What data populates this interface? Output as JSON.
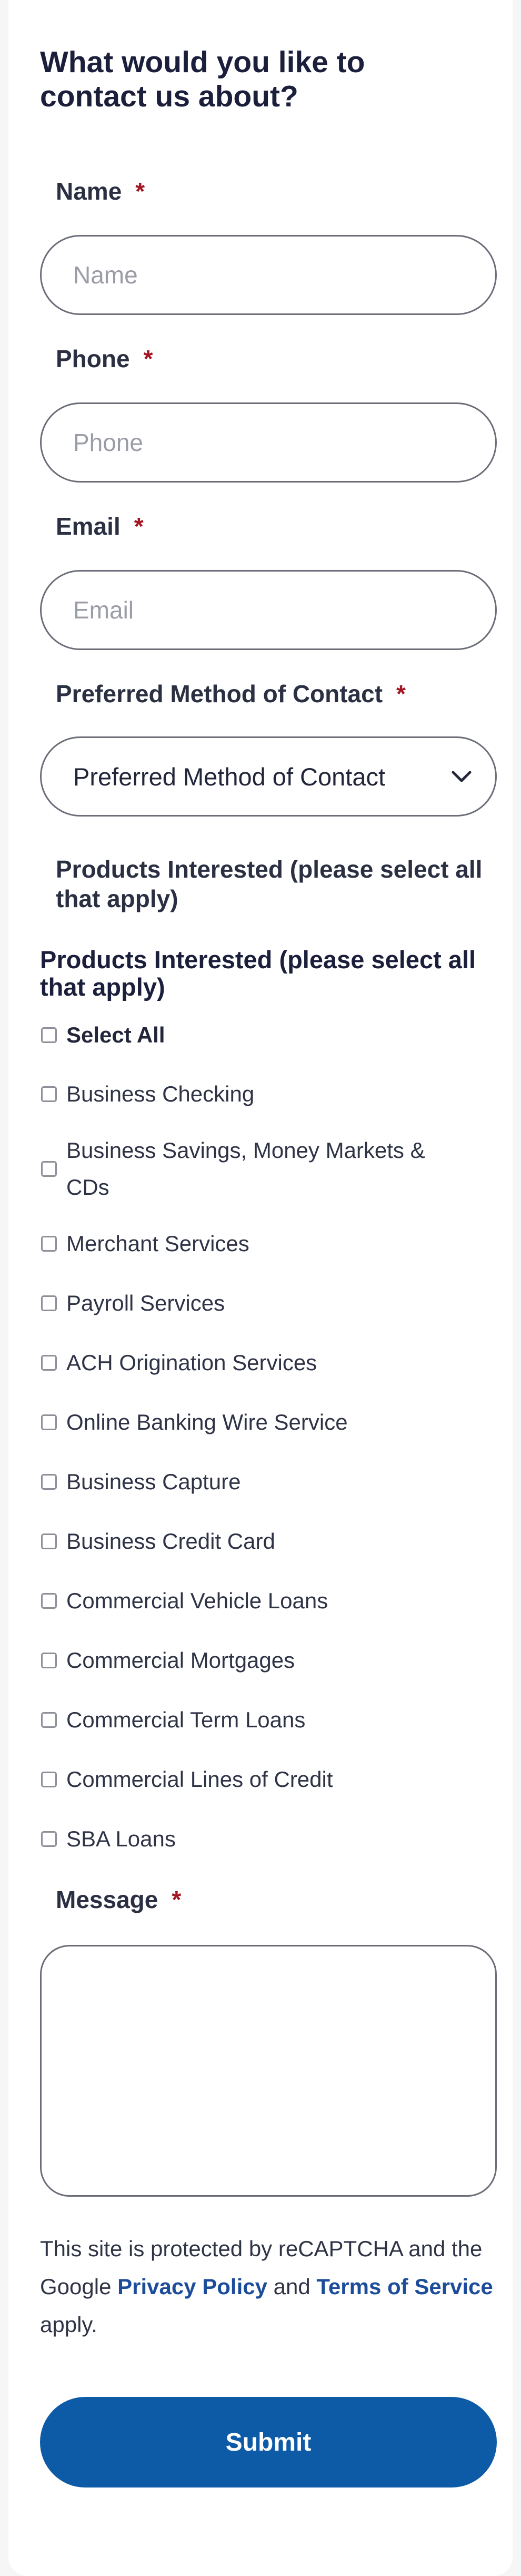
{
  "form": {
    "title": "What would you like to contact us about?",
    "required_marker": "*"
  },
  "fields": {
    "name": {
      "label": "Name",
      "placeholder": "Name"
    },
    "phone": {
      "label": "Phone",
      "placeholder": "Phone"
    },
    "email": {
      "label": "Email",
      "placeholder": "Email"
    },
    "contact_method": {
      "label": "Preferred Method of Contact",
      "selected": "Preferred Method of Contact"
    }
  },
  "products": {
    "label": "Products Interested (please select all that apply)",
    "legend": "Products Interested (please select all that apply)",
    "select_all": "Select All",
    "options": [
      "Business Checking",
      "Business Savings, Money Markets & CDs",
      "Merchant Services",
      "Payroll Services",
      "ACH Origination Services",
      "Online Banking Wire Service",
      "Business Capture",
      "Business Credit Card",
      "Commercial Vehicle Loans",
      "Commercial Mortgages",
      "Commercial Term Loans",
      "Commercial Lines of Credit",
      "SBA Loans"
    ]
  },
  "message": {
    "label": "Message"
  },
  "recaptcha": {
    "prefix": "This site is protected by reCAPTCHA and the Google",
    "privacy_link": "Privacy Policy",
    "and": "and",
    "terms_link": "Terms of Service",
    "suffix": "apply."
  },
  "submit": {
    "label": "Submit"
  },
  "colors": {
    "required": "#a31521",
    "link": "#1d4d9a",
    "button": "#0d5aa7"
  }
}
